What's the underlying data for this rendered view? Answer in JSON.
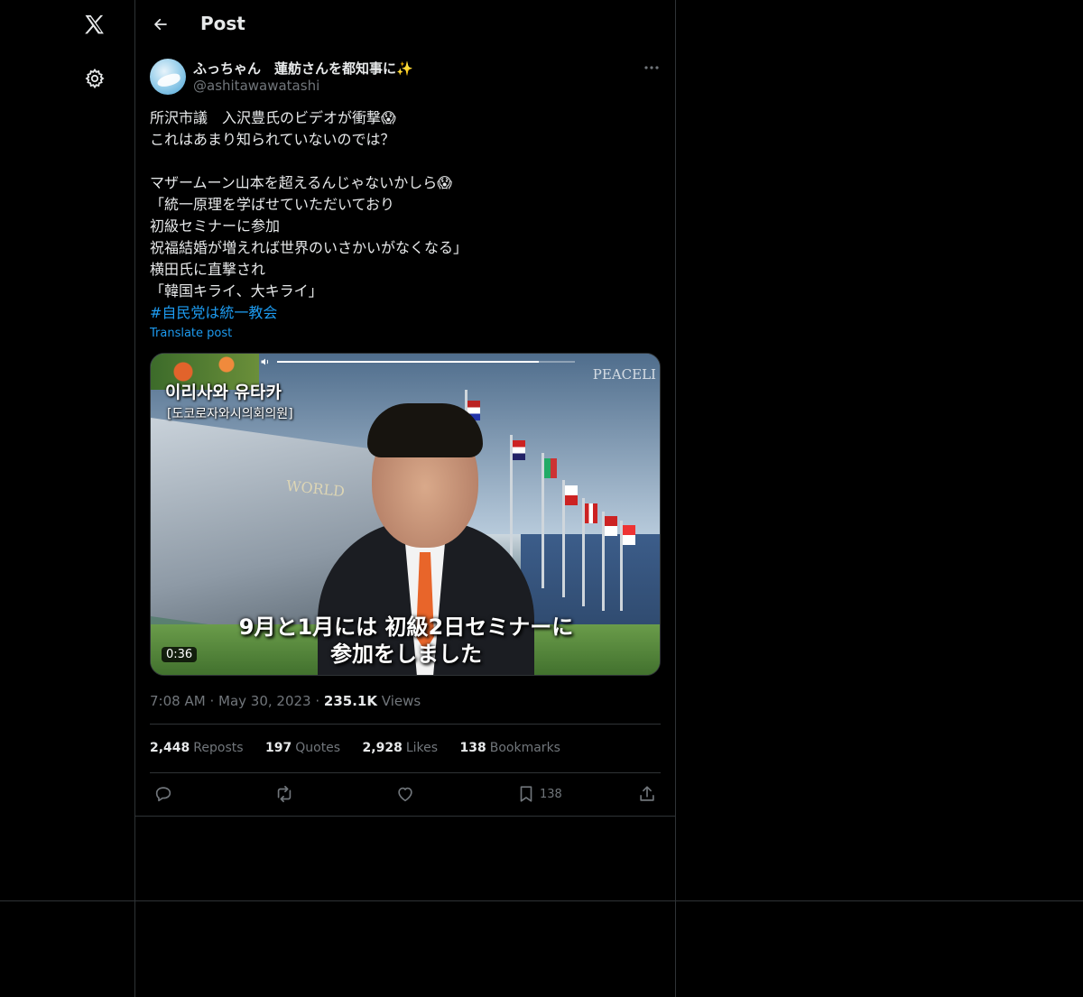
{
  "header": {
    "title": "Post"
  },
  "author": {
    "display_name": "ふっちゃん　蓮舫さんを都知事に✨",
    "handle": "@ashitawawatashi"
  },
  "post": {
    "lines": [
      "所沢市議　入沢豊氏のビデオが衝撃😱",
      "これはあまり知られていないのでは？",
      "",
      "マザームーン山本を超えるんじゃないかしら😱",
      "「統一原理を学ばせていただいており",
      "初級セミナーに参加",
      "祝福結婚が増えれば世界のいさかいがなくなる」",
      "横田氏に直撃され",
      "「韓国キライ、大キライ」"
    ],
    "hashtag": "#自民党は統一教会",
    "translate": "Translate post"
  },
  "media": {
    "overlay_title": "이리사와 유타카",
    "overlay_subtitle": "[도코로자와시의회의원]",
    "watermark": "PEACELI",
    "sign": "WORLD",
    "caption_line1": "9月と1月には 初級2日セミナーに",
    "caption_line2": "参加をしました",
    "duration": "0:36",
    "progress": 0.88
  },
  "meta": {
    "time": "7:08 AM",
    "date": "May 30, 2023",
    "dot": "·",
    "views_count": "235.1K",
    "views_label": "Views"
  },
  "stats": {
    "reposts": {
      "count": "2,448",
      "label": "Reposts"
    },
    "quotes": {
      "count": "197",
      "label": "Quotes"
    },
    "likes": {
      "count": "2,928",
      "label": "Likes"
    },
    "bookmarks": {
      "count": "138",
      "label": "Bookmarks"
    }
  },
  "actions": {
    "bookmark_count": "138"
  },
  "colors": {
    "background": "#000000",
    "text": "#e7e9ea",
    "muted": "#71767b",
    "accent": "#1d9bf0",
    "border": "#2f3336"
  },
  "icons": {
    "logo": "x-logo-icon",
    "settings": "gear-icon",
    "back": "arrow-left-icon",
    "more": "more-icon",
    "reply": "reply-icon",
    "repost": "repost-icon",
    "like": "heart-icon",
    "bookmark": "bookmark-icon",
    "share": "share-icon",
    "volume": "volume-icon"
  }
}
